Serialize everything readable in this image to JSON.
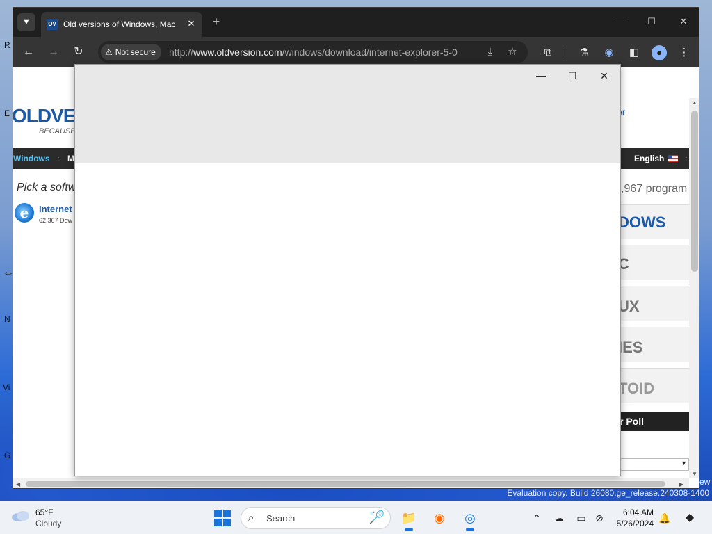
{
  "desktop": {
    "icon_letters": [
      "R",
      "E",
      "N",
      "Vi",
      "G"
    ],
    "evaluation_text": "Evaluation copy. Build 26080.ge_release.240308-1400",
    "view_text": "ew"
  },
  "browser": {
    "tab": {
      "favicon_text": "OV",
      "title": "Old versions of Windows, Mac"
    },
    "security_label": "Not secure",
    "url_prefix": "http://",
    "url_host": "www.oldversion.com",
    "url_path": "/windows/download/internet-explorer-5-0",
    "icons": {
      "tab_menu": "chevron-down-icon",
      "close_tab": "close-icon",
      "new_tab": "plus-icon",
      "back": "arrow-left-icon",
      "forward": "arrow-right-icon",
      "reload": "reload-icon",
      "download": "download-icon",
      "bookmark": "star-icon",
      "extensions": "puzzle-icon",
      "labs": "flask-icon",
      "sidepanel": "sidepanel-icon",
      "profile": "profile-icon",
      "menu": "kebab-menu-icon"
    }
  },
  "page": {
    "logo_text": "OLDVE",
    "logo_sub": "BECAUSE",
    "top_link": "ter",
    "nav_windows": "Windows",
    "nav_sep": ":",
    "nav_mac": "Ma",
    "nav_language": "English",
    "pick_text": "Pick a softw",
    "program_count": ",967 program",
    "program": {
      "name": "Internet",
      "downloads": "62,367 Dow"
    },
    "categories": [
      "DOWS",
      "C",
      "UX",
      "IES",
      "TOID"
    ],
    "poll_label": "r Poll"
  },
  "dialog": {
    "controls": [
      "minimize",
      "maximize",
      "close"
    ]
  },
  "taskbar": {
    "weather_temp": "65°F",
    "weather_desc": "Cloudy",
    "search_placeholder": "Search",
    "time": "6:04 AM",
    "date": "5/26/2024"
  },
  "colors": {
    "accent": "#1a73d9",
    "brand": "#1b5aa8",
    "nav_highlight": "#4fc3f7"
  }
}
